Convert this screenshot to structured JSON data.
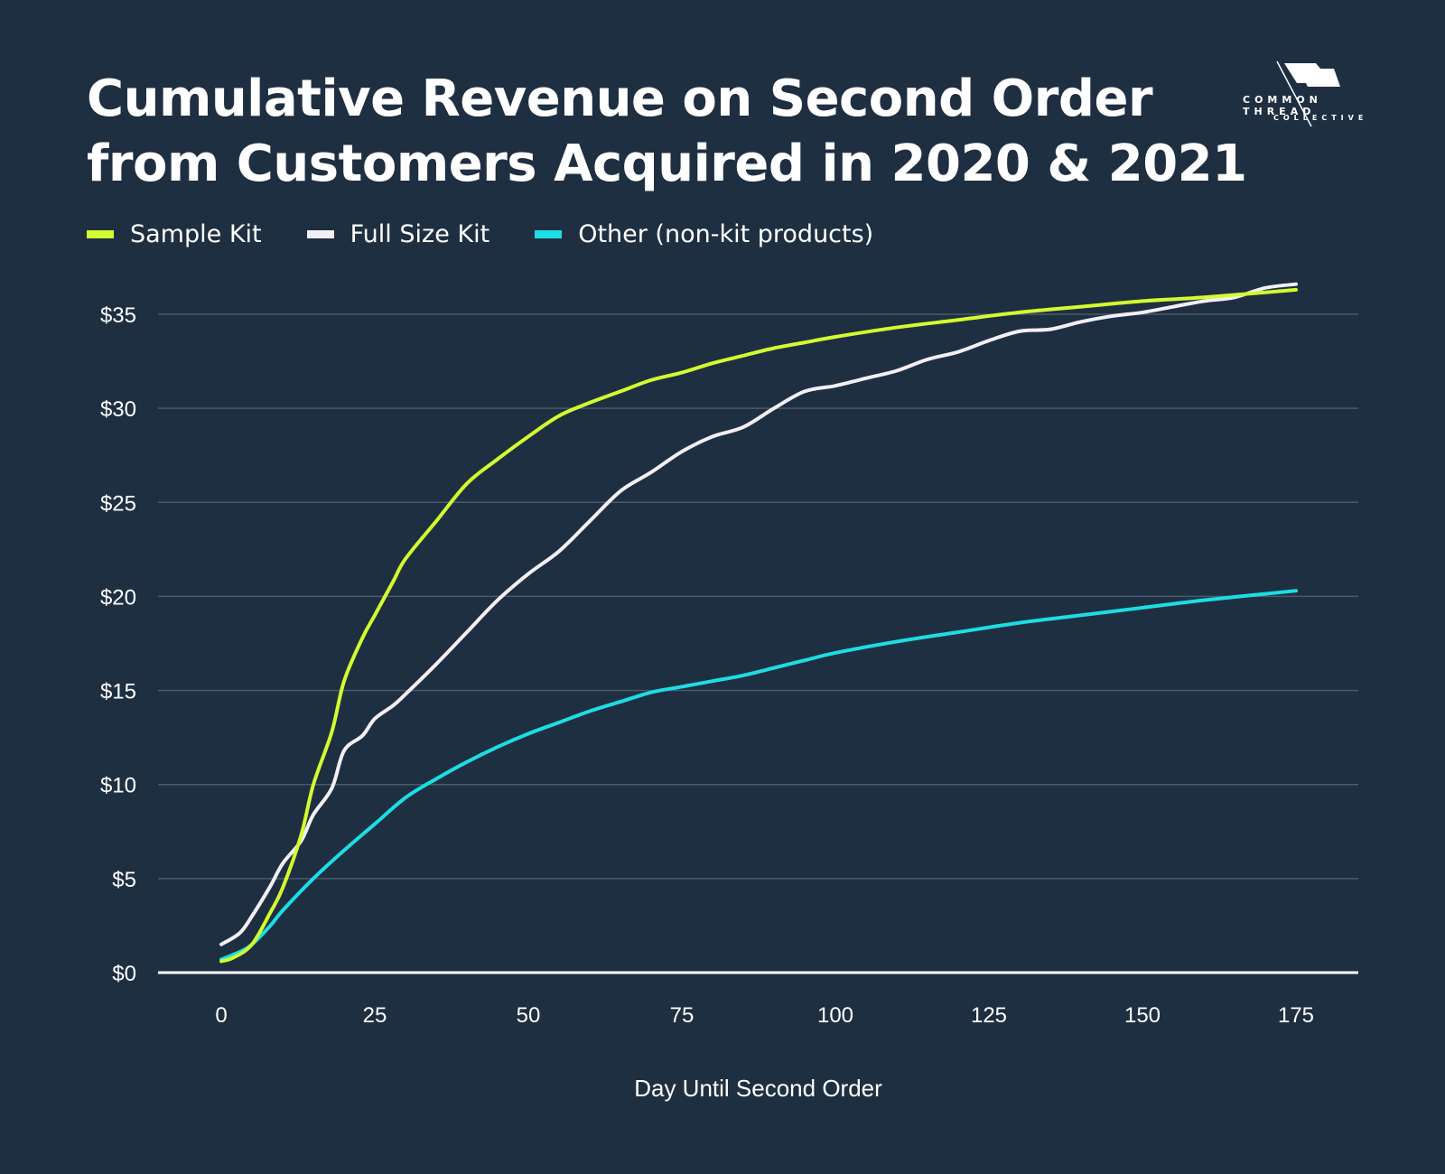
{
  "brand": {
    "line1": "COMMON THREAD",
    "line2": "COLLECTIVE",
    "icon": "flag-needle-icon"
  },
  "chart_data": {
    "type": "line",
    "title": "Cumulative Revenue on Second Order from Customers Acquired in 2020 & 2021",
    "title_lines": [
      "Cumulative Revenue on Second Order",
      "from Customers Acquired in 2020 & 2021"
    ],
    "xlabel": "Day Until Second Order",
    "ylabel": "",
    "xlim": [
      0,
      175
    ],
    "ylim": [
      0,
      35
    ],
    "xticks": [
      0,
      25,
      50,
      75,
      100,
      125,
      150,
      175
    ],
    "xtick_labels": [
      "0",
      "25",
      "50",
      "75",
      "100",
      "125",
      "150",
      "175"
    ],
    "yticks": [
      0,
      5,
      10,
      15,
      20,
      25,
      30,
      35
    ],
    "ytick_labels": [
      "$0",
      "$5",
      "$10",
      "$15",
      "$20",
      "$25",
      "$30",
      "$35"
    ],
    "grid": "horizontal",
    "legend_position": "top-left",
    "series": [
      {
        "name": "Sample Kit",
        "color": "#d4fb2f",
        "x": [
          0,
          2,
          5,
          8,
          10,
          13,
          15,
          18,
          20,
          23,
          25,
          28,
          30,
          35,
          40,
          45,
          50,
          55,
          60,
          65,
          70,
          75,
          80,
          85,
          90,
          95,
          100,
          110,
          120,
          130,
          140,
          150,
          160,
          175
        ],
        "y": [
          0.6,
          0.8,
          1.5,
          3.2,
          4.5,
          7.3,
          10,
          12.8,
          15.5,
          17.8,
          19,
          20.8,
          22,
          24,
          26,
          27.3,
          28.5,
          29.6,
          30.3,
          30.9,
          31.5,
          31.9,
          32.4,
          32.8,
          33.2,
          33.5,
          33.8,
          34.3,
          34.7,
          35.1,
          35.4,
          35.7,
          35.9,
          36.3
        ]
      },
      {
        "name": "Full Size Kit",
        "color": "#f2eff5",
        "x": [
          0,
          3,
          5,
          8,
          10,
          13,
          15,
          18,
          20,
          23,
          25,
          28,
          30,
          35,
          40,
          45,
          50,
          55,
          60,
          65,
          70,
          75,
          80,
          85,
          90,
          95,
          100,
          105,
          110,
          115,
          120,
          125,
          130,
          135,
          140,
          145,
          150,
          155,
          160,
          165,
          170,
          175
        ],
        "y": [
          1.5,
          2.1,
          3,
          4.6,
          5.8,
          7,
          8.4,
          9.8,
          11.8,
          12.6,
          13.5,
          14.2,
          14.8,
          16.4,
          18.1,
          19.8,
          21.2,
          22.4,
          24,
          25.6,
          26.6,
          27.7,
          28.5,
          29,
          30,
          30.9,
          31.2,
          31.6,
          32,
          32.6,
          33,
          33.6,
          34.1,
          34.2,
          34.6,
          34.9,
          35.1,
          35.4,
          35.7,
          35.9,
          36.4,
          36.6
        ]
      },
      {
        "name": "Other (non-kit products)",
        "color": "#1ddde3",
        "x": [
          0,
          3,
          5,
          8,
          10,
          15,
          20,
          25,
          30,
          35,
          40,
          45,
          50,
          55,
          60,
          65,
          70,
          75,
          80,
          85,
          90,
          95,
          100,
          110,
          120,
          130,
          140,
          150,
          160,
          175
        ],
        "y": [
          0.7,
          1.1,
          1.5,
          2.5,
          3.3,
          5,
          6.5,
          7.9,
          9.3,
          10.3,
          11.2,
          12,
          12.7,
          13.3,
          13.9,
          14.4,
          14.9,
          15.2,
          15.5,
          15.8,
          16.2,
          16.6,
          17,
          17.6,
          18.1,
          18.6,
          19,
          19.4,
          19.8,
          20.3
        ]
      }
    ]
  }
}
